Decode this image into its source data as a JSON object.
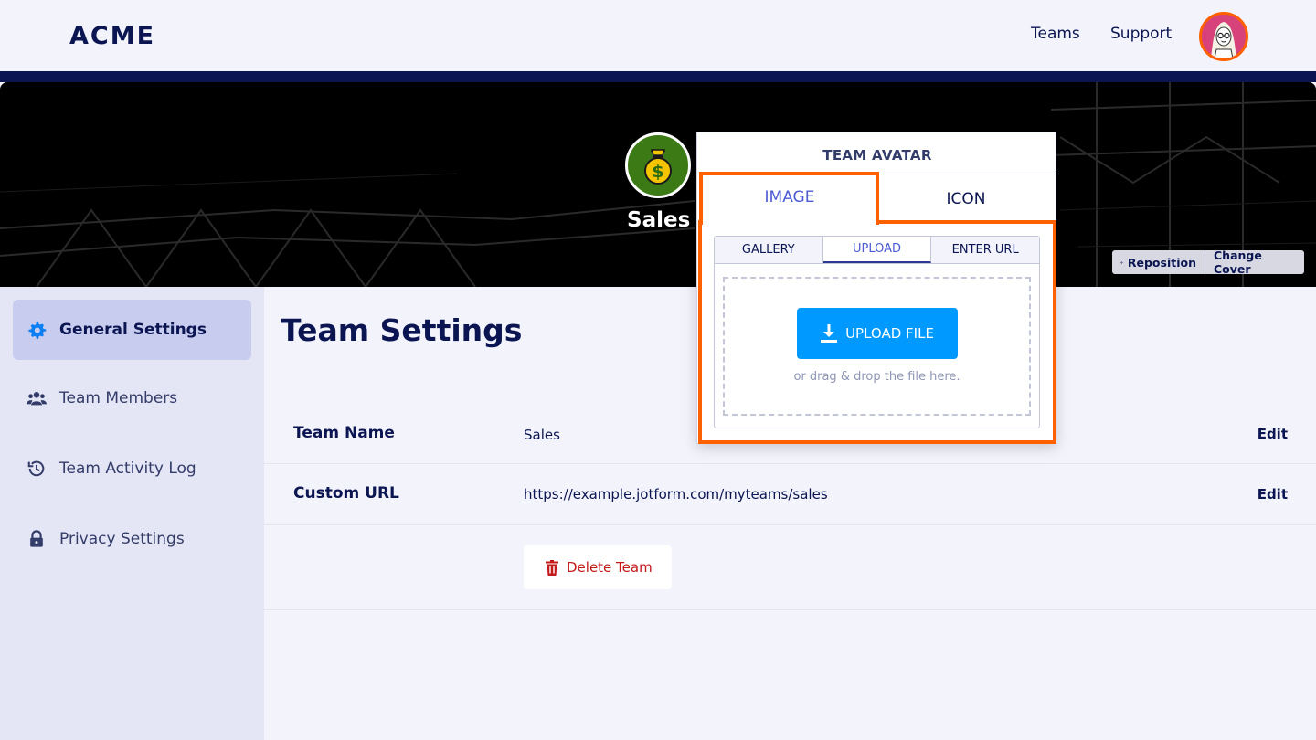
{
  "header": {
    "logo": "ACME",
    "nav": {
      "teams": "Teams",
      "support": "Support"
    }
  },
  "cover": {
    "team_name": "Sales",
    "reposition_label": "Reposition",
    "change_cover_label": "Change Cover"
  },
  "sidebar": {
    "items": [
      {
        "label": "General Settings",
        "icon": "gear-icon",
        "active": true
      },
      {
        "label": "Team Members",
        "icon": "users-icon",
        "active": false
      },
      {
        "label": "Team Activity Log",
        "icon": "history-icon",
        "active": false
      },
      {
        "label": "Privacy Settings",
        "icon": "lock-icon",
        "active": false
      }
    ]
  },
  "main": {
    "title": "Team Settings",
    "rows": [
      {
        "label": "Team Name",
        "value": "Sales",
        "action": "Edit"
      },
      {
        "label": "Custom URL",
        "value": "https://example.jotform.com/myteams/sales",
        "action": "Edit"
      }
    ],
    "delete_label": "Delete Team"
  },
  "avatar_popover": {
    "title": "TEAM AVATAR",
    "tabs": [
      "IMAGE",
      "ICON"
    ],
    "active_tab": "IMAGE",
    "sub_tabs": [
      "GALLERY",
      "UPLOAD",
      "ENTER URL"
    ],
    "active_sub_tab": "UPLOAD",
    "upload_label": "UPLOAD FILE",
    "drop_hint": "or drag & drop the file here."
  },
  "colors": {
    "navy": "#0a1551",
    "highlight": "#ff6100",
    "primary_button": "#0099ff",
    "delete_red": "#c41a1a",
    "active_tab": "#4c5bd4"
  }
}
